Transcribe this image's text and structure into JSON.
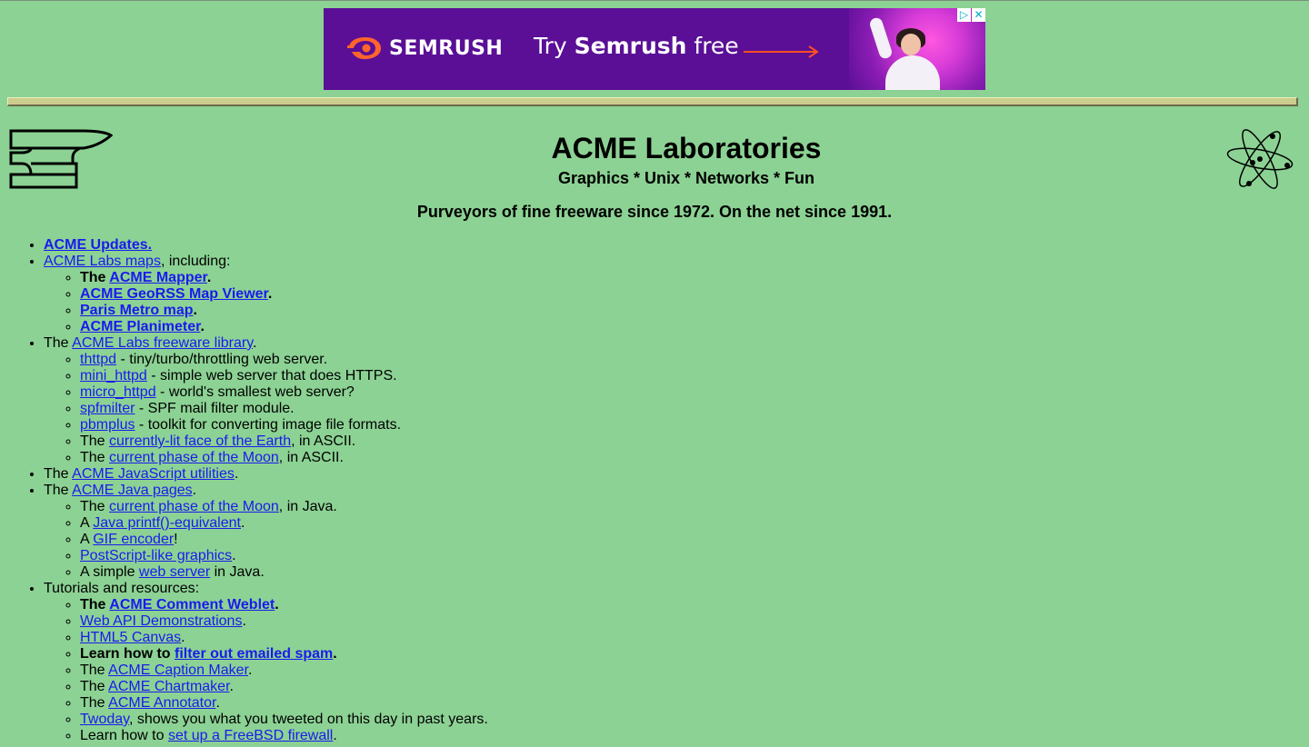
{
  "ad": {
    "brand": "SEMRUSH",
    "cta_prefix": "Try ",
    "cta_bold": "Semrush",
    "cta_suffix": " free",
    "adchoices_icon": "play-triangle-icon",
    "close_icon": "close-icon",
    "colors": {
      "background": "#5a0f96",
      "logo": "#ff642d",
      "arrow": "#ff4f24"
    }
  },
  "header": {
    "title": "ACME Laboratories",
    "subtitle": "Graphics * Unix * Networks * Fun",
    "tagline": "Purveyors of fine freeware since 1972. On the net since 1991."
  },
  "items": {
    "updates": "ACME Updates.",
    "maps_link": "ACME Labs maps",
    "maps_suffix": ", including:",
    "maps_sub": {
      "the": "The ",
      "mapper": "ACME Mapper",
      "georss": "ACME GeoRSS Map Viewer",
      "paris": "Paris Metro map",
      "planimeter": "ACME Planimeter",
      "dot": "."
    },
    "freeware_prefix": "The ",
    "freeware_link": "ACME Labs freeware library",
    "freeware_sub": {
      "thttpd": "thttpd",
      "thttpd_desc": " - tiny/turbo/throttling web server.",
      "mini_httpd": "mini_httpd",
      "mini_httpd_desc": " - simple web server that does HTTPS.",
      "micro_httpd": "micro_httpd",
      "micro_httpd_desc": " - world's smallest web server?",
      "spfmilter": "spfmilter",
      "spfmilter_desc": " - SPF mail filter module.",
      "pbmplus": "pbmplus",
      "pbmplus_desc": " - toolkit for converting image file formats.",
      "earth_prefix": "The ",
      "earth_link": "currently-lit face of the Earth",
      "earth_suffix": ", in ASCII.",
      "moon_prefix": "The ",
      "moon_link": "current phase of the Moon",
      "moon_suffix": ", in ASCII."
    },
    "js_prefix": "The ",
    "js_link": "ACME JavaScript utilities",
    "java_prefix": "The ",
    "java_link": "ACME Java pages",
    "java_sub": {
      "moon_prefix": "The ",
      "moon_link": "current phase of the Moon",
      "moon_suffix": ", in Java.",
      "printf_prefix": "A ",
      "printf_link": "Java printf()-equivalent",
      "gif_prefix": "A ",
      "gif_link": "GIF encoder",
      "gif_suffix": "!",
      "postscript_link": "PostScript-like graphics",
      "webserver_prefix": "A simple ",
      "webserver_link": "web server",
      "webserver_suffix": " in Java."
    },
    "tutorials_label": "Tutorials and resources:",
    "tutorials_sub": {
      "weblet_prefix": "The ",
      "weblet_link": "ACME Comment Weblet",
      "webapi_link": "Web API Demonstrations",
      "canvas_link": "HTML5 Canvas",
      "spam_prefix": "Learn how to ",
      "spam_link": "filter out emailed spam",
      "caption_prefix": "The ",
      "caption_link": "ACME Caption Maker",
      "chart_prefix": "The ",
      "chart_link": "ACME Chartmaker",
      "annot_prefix": "The ",
      "annot_link": "ACME Annotator",
      "twoday_link": "Twoday",
      "twoday_suffix": ", shows you what you tweeted on this day in past years.",
      "bsd_prefix": "Learn how to ",
      "bsd_link": "set up a FreeBSD firewall"
    },
    "dot": ".",
    "exclaim": "!"
  },
  "icons": {
    "left_logo": "anvil-icon",
    "right_logo": "atom-icon"
  }
}
